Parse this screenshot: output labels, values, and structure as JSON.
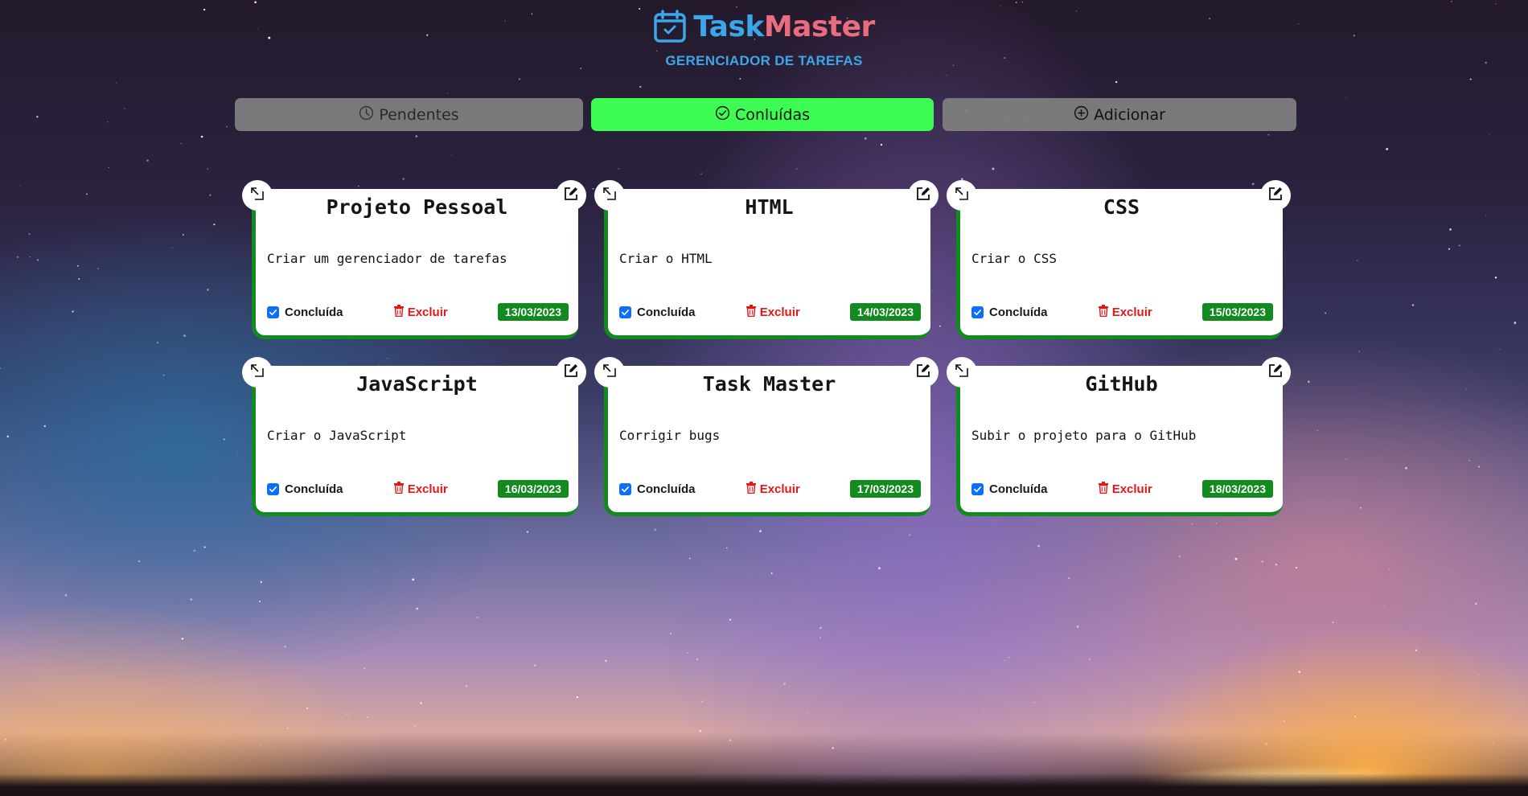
{
  "header": {
    "title_part1": "Task",
    "title_part2": "Master",
    "subtitle": "GERENCIADOR DE TAREFAS"
  },
  "tabs": [
    {
      "label": "Pendentes",
      "icon": "clock-icon",
      "active": false
    },
    {
      "label": "Conluídas",
      "icon": "check-circle-icon",
      "active": true
    },
    {
      "label": "Adicionar",
      "icon": "plus-circle-icon",
      "active": false
    }
  ],
  "tasks": [
    {
      "title": "Projeto Pessoal",
      "description": "Criar um gerenciador de tarefas",
      "status_label": "Concluída",
      "delete_label": "Excluir",
      "date": "13/03/2023",
      "done": true
    },
    {
      "title": "HTML",
      "description": "Criar o HTML",
      "status_label": "Concluída",
      "delete_label": "Excluir",
      "date": "14/03/2023",
      "done": true
    },
    {
      "title": "CSS",
      "description": "Criar o CSS",
      "status_label": "Concluída",
      "delete_label": "Excluir",
      "date": "15/03/2023",
      "done": true
    },
    {
      "title": "JavaScript",
      "description": "Criar o JavaScript",
      "status_label": "Concluída",
      "delete_label": "Excluir",
      "date": "16/03/2023",
      "done": true
    },
    {
      "title": "Task Master",
      "description": "Corrigir bugs",
      "status_label": "Concluída",
      "delete_label": "Excluir",
      "date": "17/03/2023",
      "done": true
    },
    {
      "title": "GitHub",
      "description": "Subir o projeto para o GitHub",
      "status_label": "Concluída",
      "delete_label": "Excluir",
      "date": "18/03/2023",
      "done": true
    }
  ],
  "colors": {
    "brand_blue": "#3ba7ea",
    "brand_pink": "#e96d7e",
    "active_tab": "#3dfc52",
    "card_accent": "#118a1e",
    "delete_red": "#e81515",
    "checkbox_blue": "#0d6efd"
  }
}
